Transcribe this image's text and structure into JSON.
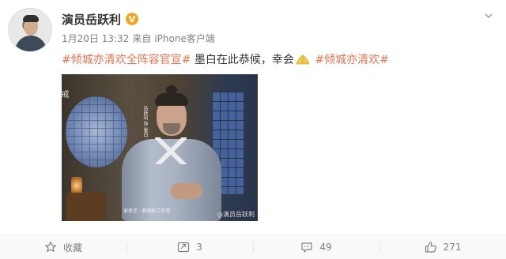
{
  "post": {
    "author": "演员岳跃利",
    "verified_badge": "V",
    "date": "1月20日 13:32",
    "source_prefix": "来自",
    "source": "iPhone客户端",
    "hashtag_1": "#倾城亦清欢全阵容官宣#",
    "text_body": "墨白在此恭候，幸会",
    "hashtag_2": "#倾城亦清欢#",
    "image": {
      "calligraphy": "戒",
      "nameplate": "岳跃利 饰 墨白",
      "logo_text": "爱奇艺 · 新丽影工作室",
      "watermark": "@演员岳跃利"
    }
  },
  "actions": {
    "favorite_label": "收藏",
    "repost_count": "3",
    "comment_count": "49",
    "like_count": "271"
  },
  "colors": {
    "hashtag": "#eb7350",
    "meta": "#808080",
    "badge": "#f5a623"
  }
}
